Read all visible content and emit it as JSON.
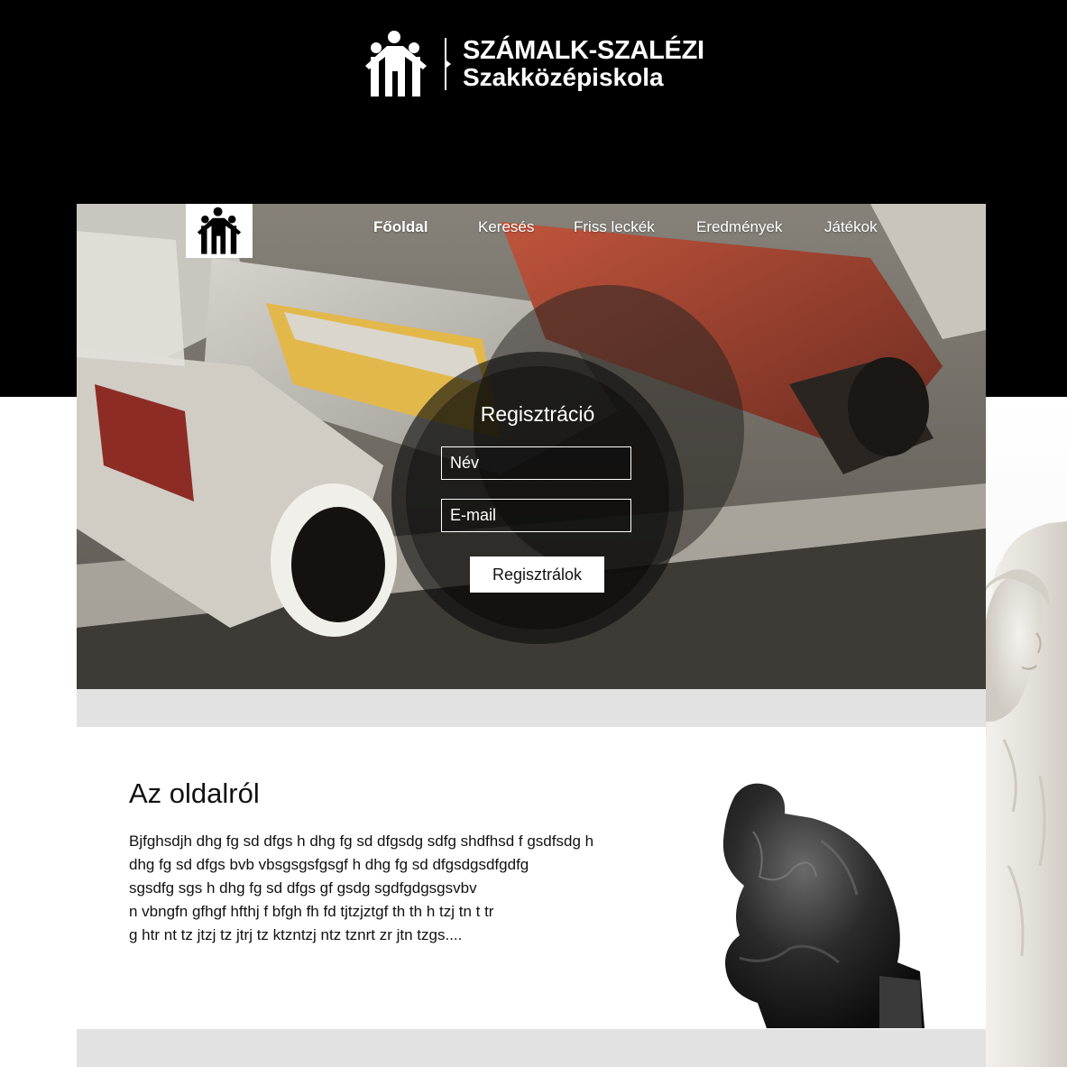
{
  "header": {
    "brand_line1": "SZÁMALK-SZALÉZI",
    "brand_line2": "Szakközépiskola",
    "logo_icon": "people-logo-icon"
  },
  "nav": {
    "logo_icon": "people-logo-icon",
    "items": [
      {
        "label": "Főoldal",
        "active": true
      },
      {
        "label": "Keresés",
        "active": false
      },
      {
        "label": "Friss leckék",
        "active": false
      },
      {
        "label": "Eredmények",
        "active": false
      },
      {
        "label": "Játékok",
        "active": false
      }
    ]
  },
  "registration": {
    "title": "Regisztráció",
    "name_placeholder": "Név",
    "email_placeholder": "E-mail",
    "submit_label": "Regisztrálok"
  },
  "about": {
    "title": "Az oldalról",
    "lines": [
      "Bjfghsdjh dhg fg sd dfgs h dhg fg sd dfgsdg sdfg shdfhsd f gsdfsdg h",
      "dhg fg sd dfgs bvb vbsgsgsfgsgf h dhg fg sd dfgsdgsdfgdfg",
      "sgsdfg sgs h dhg fg sd dfgs  gf gsdg sgdfgdgsgsvbv",
      "n vbngfn gfhgf hfthj f bfgh fh fd tjtzjztgf th th h tzj tn t tr",
      "g  htr nt tz jtzj tz jtrj tz ktzntzj ntz tznrt zr jtn tzgs...."
    ]
  },
  "colors": {
    "top_band": "#000000",
    "gray_band": "#e2e2e2",
    "text": "#111111"
  }
}
